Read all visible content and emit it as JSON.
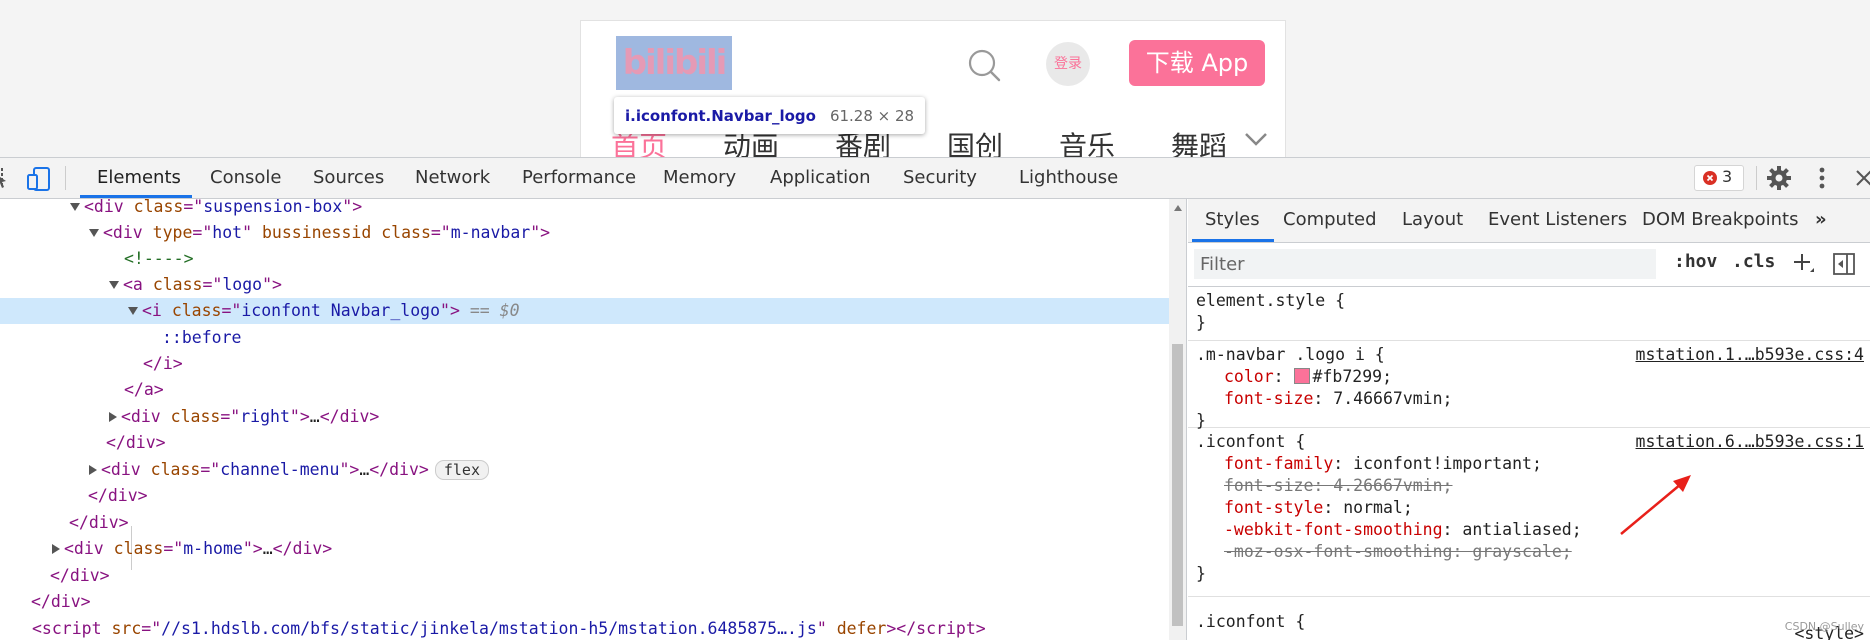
{
  "preview": {
    "logo_text": "bilibili",
    "login_label": "登录",
    "download_label": "下载 App",
    "channels": [
      "首页",
      "动画",
      "番剧",
      "国创",
      "音乐",
      "舞蹈"
    ],
    "tooltip": {
      "name": "i.iconfont.Navbar_logo",
      "size": "61.28 × 28"
    }
  },
  "devtools": {
    "tabs": [
      "Elements",
      "Console",
      "Sources",
      "Network",
      "Performance",
      "Memory",
      "Application",
      "Security",
      "Lighthouse"
    ],
    "active_tab": "Elements",
    "error_count": "3",
    "icons": [
      "inspect-icon",
      "device-toolbar-icon",
      "gear-icon",
      "more-vert-icon",
      "close-icon"
    ]
  },
  "dom": {
    "l1_tag_open": "<div ",
    "l1_attr": "class",
    "l1_eq": "=\"",
    "l1_val": "suspension-box",
    "l1_close": "\">",
    "l2_a1": "type",
    "l2_v1": "hot",
    "l2_a2": "bussinessid",
    "l2_a3": "class",
    "l2_v3": "m-navbar",
    "l3_comment": "<!---->",
    "l4_attr": "class",
    "l4_val": "logo",
    "l5_attr": "class",
    "l5_val": "iconfont Navbar_logo",
    "l5_eq": " == ",
    "l5_ref": "$0",
    "l6_pseudo": "::before",
    "l7_close": "</i>",
    "l8_close": "</a>",
    "l9_attr": "class",
    "l9_val": "right",
    "l9_ellipsis": "…",
    "l10_close": "</div>",
    "l11_attr": "class",
    "l11_val": "channel-menu",
    "l11_ellipsis": "…",
    "l11_badge": "flex",
    "l12_close": "</div>",
    "l13_close": "</div>",
    "l14_attr": "class",
    "l14_val": "m-home",
    "l14_ellipsis": "…",
    "l15_close": "</div>",
    "l16_close": "</div>",
    "l17_attr1": "src",
    "l17_val1": "//s1.hdslb.com/bfs/static/jinkela/mstation-h5/mstation.6485875….js",
    "l17_attr2": "defer"
  },
  "styles": {
    "tabs": [
      "Styles",
      "Computed",
      "Layout",
      "Event Listeners",
      "DOM Breakpoints"
    ],
    "active_tab": "Styles",
    "filter_placeholder": "Filter",
    "hov_label": ":hov",
    "cls_label": ".cls",
    "rules": {
      "r1_selector": "element.style {",
      "r1_close": "}",
      "r2_selector": ".m-navbar .logo i {",
      "r2_source": "mstation.1.…b593e.css:4",
      "r2_p1_name": "color",
      "r2_p1_value": "#fb7299;",
      "r2_swatch": "#fb7299",
      "r2_p2_name": "font-size",
      "r2_p2_value": "7.46667vmin;",
      "r2_close": "}",
      "r3_selector": ".iconfont {",
      "r3_source": "mstation.6.…b593e.css:1",
      "r3_p1_name": "font-family",
      "r3_p1_value": "iconfont!important;",
      "r3_p2_name": "font-size",
      "r3_p2_value": "4.26667vmin;",
      "r3_p3_name": "font-style",
      "r3_p3_value": "normal;",
      "r3_p4_name": "-webkit-font-smoothing",
      "r3_p4_value": "antialiased;",
      "r3_p5_name": "-moz-osx-font-smoothing",
      "r3_p5_value": "grayscale;",
      "r3_close": "}",
      "r4_selector": ".iconfont {",
      "r4_source": "<style>"
    }
  },
  "watermark": "CSDN @Sulley",
  "colors": {
    "accent": "#fb7299",
    "devtools_blue": "#1a73e8",
    "selected_row": "#cfe8fc",
    "arrow": "#e8201a"
  }
}
